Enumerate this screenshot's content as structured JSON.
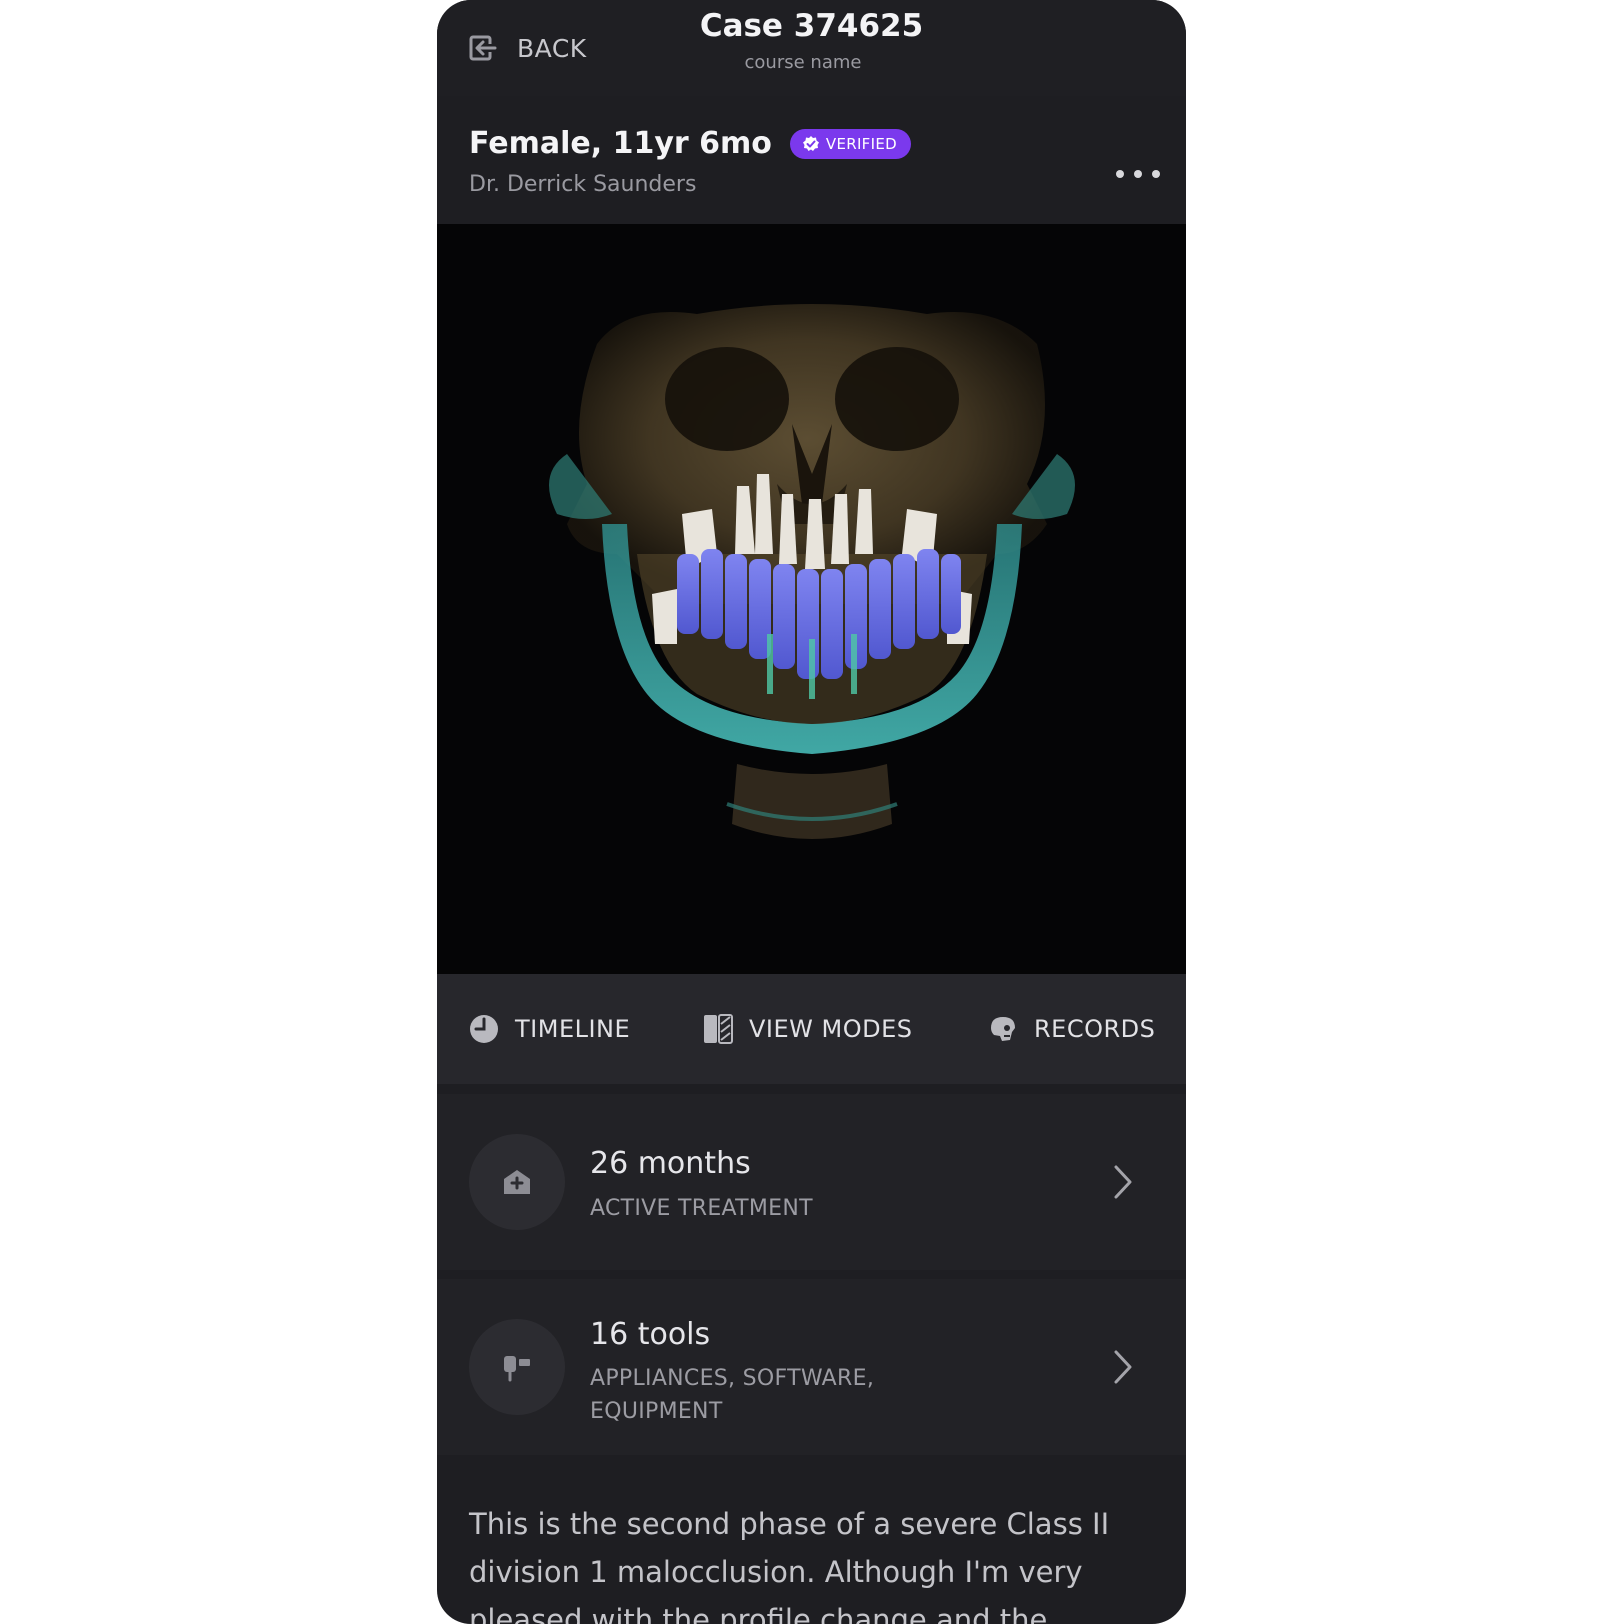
{
  "header": {
    "back_label": "BACK",
    "case_title": "Case 374625",
    "course_label": "course name"
  },
  "patient": {
    "name_age": "Female, 11yr 6mo",
    "badge": "VERIFIED",
    "doctor": "Dr. Derrick Saunders"
  },
  "actions": [
    {
      "label": "TIMELINE",
      "icon": "clock-icon"
    },
    {
      "label": "VIEW MODES",
      "icon": "split-view-icon"
    },
    {
      "label": "RECORDS",
      "icon": "skull-icon"
    }
  ],
  "cards": [
    {
      "title": "26 months",
      "subtitle": "ACTIVE TREATMENT",
      "icon": "medical-house-icon"
    },
    {
      "title": "16 tools",
      "subtitle": "APPLIANCES, SOFTWARE, EQUIPMENT",
      "icon": "tool-icon"
    }
  ],
  "description": "This is the second phase of a severe Class II division 1 malocclusion. Although I'm very pleased with the profile change and the",
  "colors": {
    "background": "#1e1e22",
    "accent": "#7b39ed",
    "text_primary": "#f4f4f6",
    "text_secondary": "#9a9aa1"
  }
}
